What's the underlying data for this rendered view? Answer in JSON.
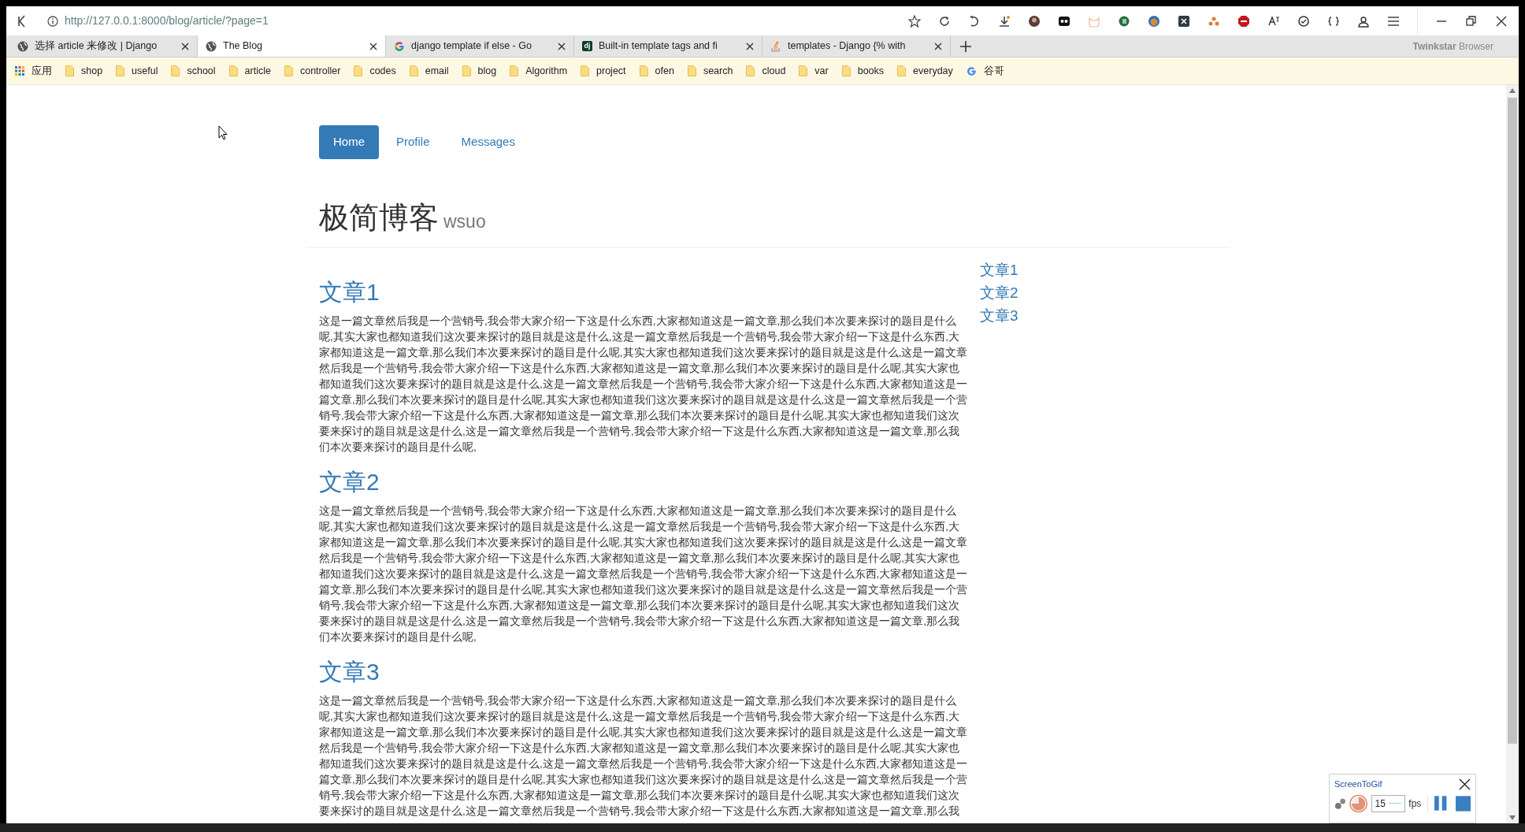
{
  "address_bar": {
    "url": "http://127.0.0.1:8000/blog/article/?page=1"
  },
  "tabs": [
    {
      "title": "选择 article 来修改 | Django",
      "kind": "globe",
      "selected": false
    },
    {
      "title": "The Blog",
      "kind": "globe",
      "selected": true
    },
    {
      "title": "django template if else - Go",
      "kind": "google",
      "selected": false
    },
    {
      "title": "Built-in template tags and fi",
      "kind": "letters",
      "icon_text": "dj",
      "selected": false
    },
    {
      "title": "templates - Django {% with",
      "kind": "stack",
      "selected": false
    }
  ],
  "browser_name": "**Twinkstar** Browser",
  "bookmarks": [
    {
      "label": "应用",
      "kind": "apps"
    },
    {
      "label": "shop",
      "kind": "folder"
    },
    {
      "label": "useful",
      "kind": "folder"
    },
    {
      "label": "school",
      "kind": "folder"
    },
    {
      "label": "article",
      "kind": "folder"
    },
    {
      "label": "controller",
      "kind": "folder"
    },
    {
      "label": "codes",
      "kind": "folder"
    },
    {
      "label": "email",
      "kind": "folder"
    },
    {
      "label": "blog",
      "kind": "folder"
    },
    {
      "label": "Algorithm",
      "kind": "folder"
    },
    {
      "label": "project",
      "kind": "folder"
    },
    {
      "label": "ofen",
      "kind": "folder"
    },
    {
      "label": "search",
      "kind": "folder"
    },
    {
      "label": "cloud",
      "kind": "folder"
    },
    {
      "label": "var",
      "kind": "folder"
    },
    {
      "label": "books",
      "kind": "folder"
    },
    {
      "label": "everyday",
      "kind": "folder"
    },
    {
      "label": "谷哥",
      "kind": "google"
    }
  ],
  "page": {
    "nav": [
      {
        "label": "Home",
        "selected": true
      },
      {
        "label": "Profile",
        "selected": false
      },
      {
        "label": "Messages",
        "selected": false
      }
    ],
    "title": "极简博客",
    "subtitle": "wsuo",
    "articles": [
      {
        "title": "文章1",
        "body": "这是一篇文章然后我是一个营销号,我会带大家介绍一下这是什么东西,大家都知道这是一篇文章,那么我们本次要来探讨的题目是什么呢,其实大家也都知道我们这次要来探讨的题目就是这是什么,这是一篇文章然后我是一个营销号,我会带大家介绍一下这是什么东西,大家都知道这是一篇文章,那么我们本次要来探讨的题目是什么呢,其实大家也都知道我们这次要来探讨的题目就是这是什么,这是一篇文章然后我是一个营销号,我会带大家介绍一下这是什么东西,大家都知道这是一篇文章,那么我们本次要来探讨的题目是什么呢,其实大家也都知道我们这次要来探讨的题目就是这是什么,这是一篇文章然后我是一个营销号,我会带大家介绍一下这是什么东西,大家都知道这是一篇文章,那么我们本次要来探讨的题目是什么呢,其实大家也都知道我们这次要来探讨的题目就是这是什么,这是一篇文章然后我是一个营销号,我会带大家介绍一下这是什么东西,大家都知道这是一篇文章,那么我们本次要来探讨的题目是什么呢,其实大家也都知道我们这次要来探讨的题目就是这是什么,这是一篇文章然后我是一个营销号,我会带大家介绍一下这是什么东西,大家都知道这是一篇文章,那么我们本次要来探讨的题目是什么呢,"
      },
      {
        "title": "文章2",
        "body": "这是一篇文章然后我是一个营销号,我会带大家介绍一下这是什么东西,大家都知道这是一篇文章,那么我们本次要来探讨的题目是什么呢,其实大家也都知道我们这次要来探讨的题目就是这是什么,这是一篇文章然后我是一个营销号,我会带大家介绍一下这是什么东西,大家都知道这是一篇文章,那么我们本次要来探讨的题目是什么呢,其实大家也都知道我们这次要来探讨的题目就是这是什么,这是一篇文章然后我是一个营销号,我会带大家介绍一下这是什么东西,大家都知道这是一篇文章,那么我们本次要来探讨的题目是什么呢,其实大家也都知道我们这次要来探讨的题目就是这是什么,这是一篇文章然后我是一个营销号,我会带大家介绍一下这是什么东西,大家都知道这是一篇文章,那么我们本次要来探讨的题目是什么呢,其实大家也都知道我们这次要来探讨的题目就是这是什么,这是一篇文章然后我是一个营销号,我会带大家介绍一下这是什么东西,大家都知道这是一篇文章,那么我们本次要来探讨的题目是什么呢,其实大家也都知道我们这次要来探讨的题目就是这是什么,这是一篇文章然后我是一个营销号,我会带大家介绍一下这是什么东西,大家都知道这是一篇文章,那么我们本次要来探讨的题目是什么呢,"
      },
      {
        "title": "文章3",
        "body": "这是一篇文章然后我是一个营销号,我会带大家介绍一下这是什么东西,大家都知道这是一篇文章,那么我们本次要来探讨的题目是什么呢,其实大家也都知道我们这次要来探讨的题目就是这是什么,这是一篇文章然后我是一个营销号,我会带大家介绍一下这是什么东西,大家都知道这是一篇文章,那么我们本次要来探讨的题目是什么呢,其实大家也都知道我们这次要来探讨的题目就是这是什么,这是一篇文章然后我是一个营销号,我会带大家介绍一下这是什么东西,大家都知道这是一篇文章,那么我们本次要来探讨的题目是什么呢,其实大家也都知道我们这次要来探讨的题目就是这是什么,这是一篇文章然后我是一个营销号,我会带大家介绍一下这是什么东西,大家都知道这是一篇文章,那么我们本次要来探讨的题目是什么呢,其实大家也都知道我们这次要来探讨的题目就是这是什么,这是一篇文章然后我是一个营销号,我会带大家介绍一下这是什么东西,大家都知道这是一篇文章,那么我们本次要来探讨的题目是什么呢,其实大家也都知道我们这次要来探讨的题目就是这是什么,这是一篇文章然后我是一个营销号,我会带大家介绍一下这是什么东西,大家都知道这是一篇文章,那么我"
      }
    ],
    "sidebar_links": [
      "文章1",
      "文章2",
      "文章3"
    ]
  },
  "recorder": {
    "title": "ScreenToGif",
    "fps_value": "15",
    "fps_label": "fps"
  }
}
